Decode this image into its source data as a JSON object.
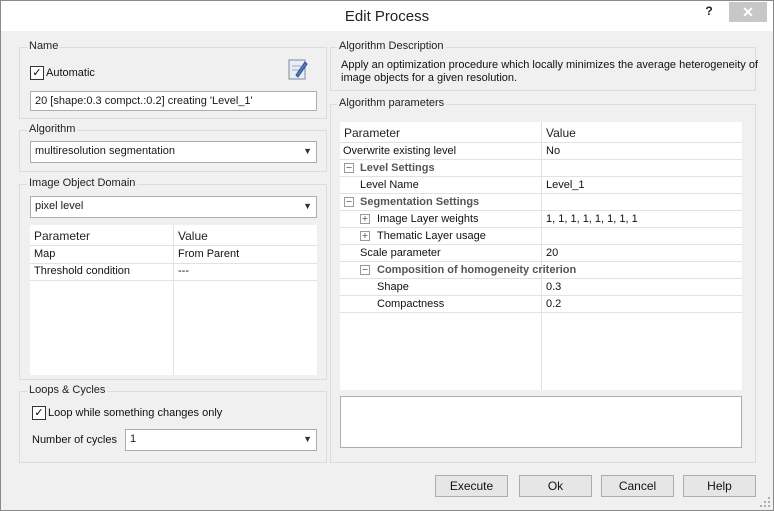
{
  "window": {
    "title": "Edit Process",
    "help_glyph": "?",
    "close_glyph": "✕"
  },
  "name_group": {
    "label": "Name",
    "automatic_label": "Automatic",
    "automatic_checked": true,
    "value": "20 [shape:0.3 compct.:0.2] creating 'Level_1'"
  },
  "algorithm_group": {
    "label": "Algorithm",
    "selected": "multiresolution segmentation"
  },
  "domain_group": {
    "label": "Image Object Domain",
    "selected": "pixel level",
    "table": {
      "headers": [
        "Parameter",
        "Value"
      ],
      "rows": [
        [
          "Map",
          "From Parent"
        ],
        [
          "Threshold condition",
          "---"
        ]
      ]
    }
  },
  "loops_group": {
    "label": "Loops & Cycles",
    "loop_label": "Loop while something changes only",
    "loop_checked": true,
    "cycles_label": "Number of cycles",
    "cycles_value": "1"
  },
  "description_group": {
    "label": "Algorithm Description",
    "line1": "Apply an optimization procedure which locally minimizes the average heterogeneity of",
    "line2": "image objects for a given resolution."
  },
  "params_group": {
    "label": "Algorithm parameters",
    "headers": [
      "Parameter",
      "Value"
    ],
    "rows": {
      "overwrite": [
        "Overwrite existing level",
        "No"
      ],
      "level_settings": "Level Settings",
      "level_name": [
        "Level Name",
        "Level_1"
      ],
      "segmentation_settings": "Segmentation Settings",
      "layer_weights": [
        "Image Layer weights",
        "1, 1, 1, 1, 1, 1, 1, 1"
      ],
      "thematic_usage": [
        "Thematic Layer usage",
        ""
      ],
      "scale": [
        "Scale parameter",
        "20"
      ],
      "composition": "Composition of homogeneity criterion",
      "shape": [
        "Shape",
        "0.3"
      ],
      "compactness": [
        "Compactness",
        "0.2"
      ]
    }
  },
  "buttons": {
    "execute": "Execute",
    "ok": "Ok",
    "cancel": "Cancel",
    "help": "Help"
  },
  "glyphs": {
    "check": "✓",
    "collapse": "−",
    "expand": "+",
    "dropdown": "▼"
  }
}
